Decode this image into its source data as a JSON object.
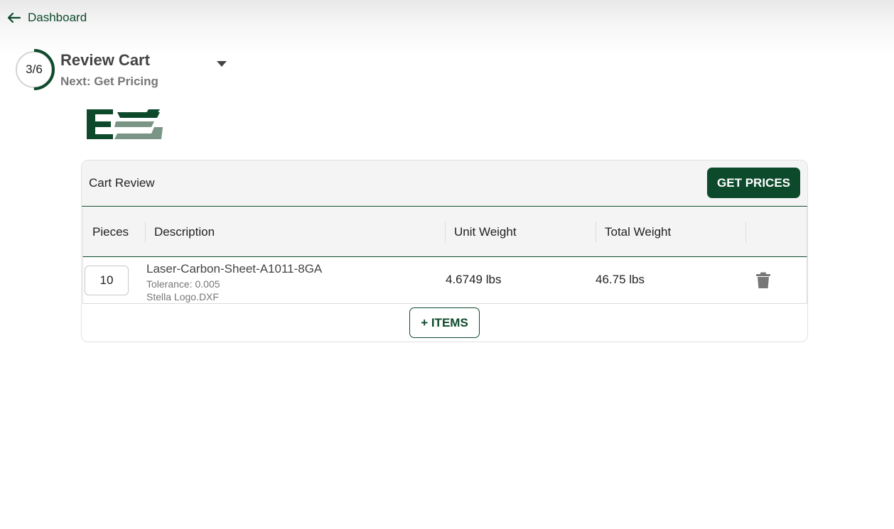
{
  "nav": {
    "back_label": "Dashboard"
  },
  "stepper": {
    "progress_text": "3/6",
    "current_step": 3,
    "total_steps": 6,
    "title": "Review Cart",
    "next_label": "Next: Get Pricing"
  },
  "brand": {
    "primary_color": "#0d4a2c",
    "secondary_color": "#7a9585"
  },
  "cart": {
    "title": "Cart Review",
    "get_prices_label": "GET PRICES",
    "columns": [
      "Pieces",
      "Description",
      "Unit Weight",
      "Total Weight"
    ],
    "items": [
      {
        "pieces": "10",
        "description": "Laser-Carbon-Sheet-A1011-8GA",
        "tolerance": "Tolerance: 0.005",
        "file": "Stella Logo.DXF",
        "unit_weight": "4.6749 lbs",
        "total_weight": "46.75 lbs"
      }
    ],
    "add_items_label": "+ ITEMS"
  },
  "icons": {
    "back": "arrow-left-icon",
    "dropdown": "caret-down-icon",
    "delete": "trash-icon"
  }
}
